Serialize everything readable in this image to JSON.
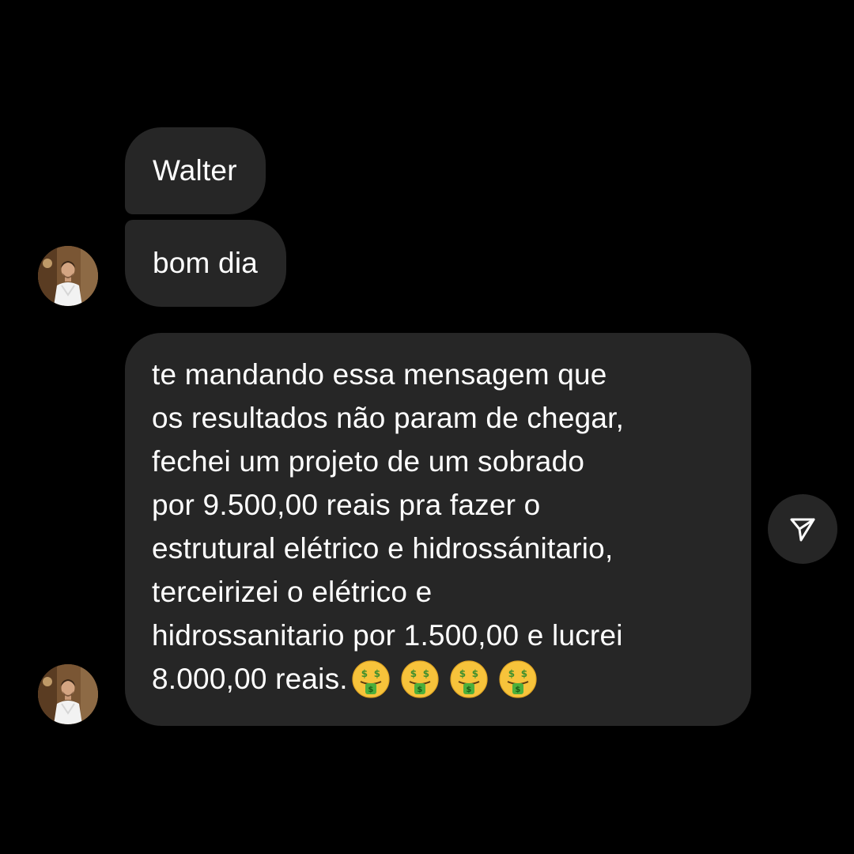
{
  "messages": [
    {
      "text": "Walter"
    },
    {
      "text": "bom dia"
    },
    {
      "lines": [
        "te mandando essa mensagem que",
        "os resultados não param de chegar,",
        "fechei um projeto de um sobrado",
        "por 9.500,00 reais pra fazer o",
        "estrutural elétrico e hidrossánitario,",
        "terceirizei o elétrico e",
        "hidrossanitario por 1.500,00 e lucrei",
        "8.000,00 reais."
      ],
      "emojis": [
        "money-mouth-face",
        "money-mouth-face",
        "money-mouth-face",
        "money-mouth-face"
      ]
    }
  ],
  "icons": {
    "share": "paper-plane-icon",
    "avatar": "profile-photo"
  },
  "colors": {
    "background": "#000000",
    "bubble": "#262626",
    "text": "#ffffff"
  }
}
